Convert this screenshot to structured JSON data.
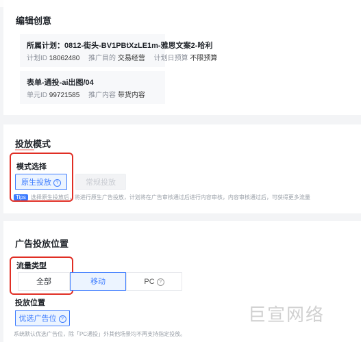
{
  "edit": {
    "title": "编辑创意",
    "plan": {
      "title": "所属计划：0812-街头-BV1PBtXzLE1m-雅思文案2-哈利",
      "meta": [
        {
          "key": "计划ID",
          "value": "18062480"
        },
        {
          "key": "推广目的",
          "value": "交易经营"
        },
        {
          "key": "计划日预算",
          "value": "不限预算"
        }
      ]
    },
    "unit": {
      "title": "表单-通投-ai出图/04",
      "meta": [
        {
          "key": "单元ID",
          "value": "99721585"
        },
        {
          "key": "推广内容",
          "value": "带货内容"
        }
      ]
    }
  },
  "delivery_mode": {
    "title": "投放模式",
    "sub_label": "模式选择",
    "options": [
      "原生投放",
      "常规投放"
    ],
    "selected": "原生投放",
    "tip_badge": "Tips",
    "tip_text": "选择原生投放后，将进行原生广告投放，计划将在广告审核通过后进行内容审核，内容审核通过后，可获得更多流量"
  },
  "placement": {
    "title": "广告投放位置",
    "traffic_label": "流量类型",
    "traffic_options": [
      "全部",
      "移动",
      "PC"
    ],
    "traffic_selected": "移动",
    "position_label": "投放位置",
    "position_button": "优选广告位",
    "footnote": "系统默认优选广告位，除「PC通投」外其他场景均不再支持指定投放。"
  },
  "watermark": "巨宣网络",
  "colors": {
    "accent": "#3c7bff",
    "annotation": "#e02e24"
  }
}
